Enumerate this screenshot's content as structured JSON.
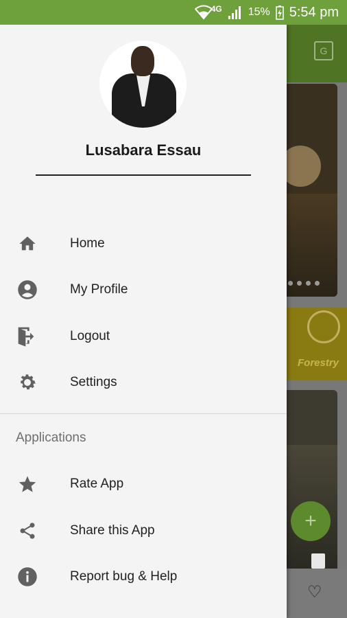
{
  "status_bar": {
    "network": "4G",
    "battery": "15%",
    "time": "5:54 pm",
    "icons": [
      "wifi-icon",
      "signal-icon",
      "battery-charging-icon"
    ]
  },
  "background_app": {
    "category_label": "Forestry",
    "icons": [
      "translate-icon",
      "globe-icon",
      "add-icon",
      "heart-icon"
    ]
  },
  "drawer": {
    "user_name": "Lusabara Essau",
    "menu": [
      {
        "label": "Home",
        "icon": "home-icon"
      },
      {
        "label": "My Profile",
        "icon": "account-circle-icon"
      },
      {
        "label": "Logout",
        "icon": "logout-door-icon"
      },
      {
        "label": "Settings",
        "icon": "gear-icon"
      }
    ],
    "section_title": "Applications",
    "app_menu": [
      {
        "label": "Rate App",
        "icon": "star-icon"
      },
      {
        "label": "Share this App",
        "icon": "share-icon"
      },
      {
        "label": "Report bug & Help",
        "icon": "info-icon"
      }
    ]
  },
  "colors": {
    "status_bar": "#6ea13b",
    "drawer_bg": "#f4f4f4",
    "icon_grey": "#616161"
  }
}
